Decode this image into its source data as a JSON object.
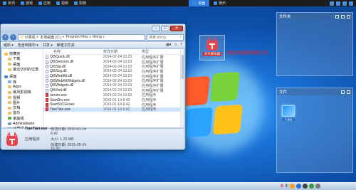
{
  "topbar": {
    "items": [
      "资讯",
      "游戏",
      "应用",
      "视频",
      "购物"
    ],
    "tabs": [
      {
        "label": "桌面",
        "active": true
      },
      {
        "label": "娱乐",
        "active": false
      }
    ]
  },
  "explorer": {
    "path": [
      "计算机",
      "本地磁盘 (C:)",
      "Program Files",
      "ttmng"
    ],
    "search_placeholder": "搜索 ttmng",
    "toolbar": [
      "组织 ▾",
      "包含到库中 ▾",
      "共享 ▾",
      "新建文件夹"
    ],
    "nav": [
      {
        "label": "收藏夹",
        "kind": "star"
      },
      {
        "label": "下载",
        "kind": "folder",
        "sub": true
      },
      {
        "label": "桌面",
        "kind": "folder",
        "sub": true
      },
      {
        "label": "最近访问的位置",
        "kind": "folder",
        "sub": true
      },
      {
        "label": "桌面",
        "kind": "desk",
        "gap": true
      },
      {
        "label": "库",
        "kind": "lib",
        "sub": true
      },
      {
        "label": "Apps",
        "kind": "folder",
        "sub": true
      },
      {
        "label": "暴风影视库",
        "kind": "folder",
        "sub": true
      },
      {
        "label": "视频",
        "kind": "folder",
        "sub": true
      },
      {
        "label": "图片",
        "kind": "folder",
        "sub": true
      },
      {
        "label": "文档",
        "kind": "folder",
        "sub": true
      },
      {
        "label": "音乐",
        "kind": "folder",
        "sub": true
      },
      {
        "label": "家庭组",
        "kind": "home",
        "sub": true
      },
      {
        "label": "Administrator",
        "kind": "user",
        "sub": true
      },
      {
        "label": "计算机",
        "kind": "pc",
        "sub": true
      }
    ],
    "columns": [
      "名称",
      "修改日期",
      "类型"
    ],
    "files": [
      {
        "name": "Qt5Quick.dll",
        "date": "2014-02-24 13:23",
        "type": "应用程序扩展",
        "exe": false
      },
      {
        "name": "Qt5Sensors.dll",
        "date": "2014-02-24 13:23",
        "type": "应用程序扩展",
        "exe": false
      },
      {
        "name": "Qt5Sql.dll",
        "date": "2014-02-24 13:23",
        "type": "应用程序扩展",
        "exe": false
      },
      {
        "name": "Qt5Svg.dll",
        "date": "2014-02-24 13:23",
        "type": "应用程序扩展",
        "exe": false
      },
      {
        "name": "Qt5WebKit.dll",
        "date": "2014-02-24 13:23",
        "type": "应用程序扩展",
        "exe": false
      },
      {
        "name": "Qt5WebKitWidgets.dll",
        "date": "2014-02-24 13:23",
        "type": "应用程序扩展",
        "exe": false
      },
      {
        "name": "Qt5Widgets.dll",
        "date": "2014-02-24 13:23",
        "type": "应用程序扩展",
        "exe": false
      },
      {
        "name": "Qt5Xml.dll",
        "date": "2014-02-24 13:23",
        "type": "应用程序扩展",
        "exe": false
      },
      {
        "name": "rsnum.exe",
        "date": "2014-02-24 13:23",
        "type": "应用程序",
        "exe": true
      },
      {
        "name": "StartDrv.exe",
        "date": "2015-01-14 6:42",
        "type": "应用程序",
        "exe": true
      },
      {
        "name": "StartSVCR.exe",
        "date": "2015-01-14 6:42",
        "type": "应用程序",
        "exe": true
      },
      {
        "name": "TianTian.exe",
        "date": "2015-01-14 6:42",
        "type": "应用程序",
        "exe": true,
        "selected": true
      }
    ],
    "details": {
      "name": "TianTian.exe",
      "type": "应用程序",
      "mod_label": "修改日期:",
      "mod": "2015-01-14 6:42",
      "size_label": "大小:",
      "size": "1.25 MB",
      "created_label": "创建日期:",
      "created": "2015-05-24 15:36"
    }
  },
  "desktop_icon": {
    "label": "天天模拟器"
  },
  "annotation": "发送到桌面快捷方式",
  "panels": {
    "top": {
      "title": "文件夹"
    },
    "bottom": {
      "title": "文件",
      "file": "1.jpg"
    }
  },
  "colors": {
    "accent": "#2f7be0",
    "annotation": "#e8232a",
    "app_red": "#e9454e"
  }
}
